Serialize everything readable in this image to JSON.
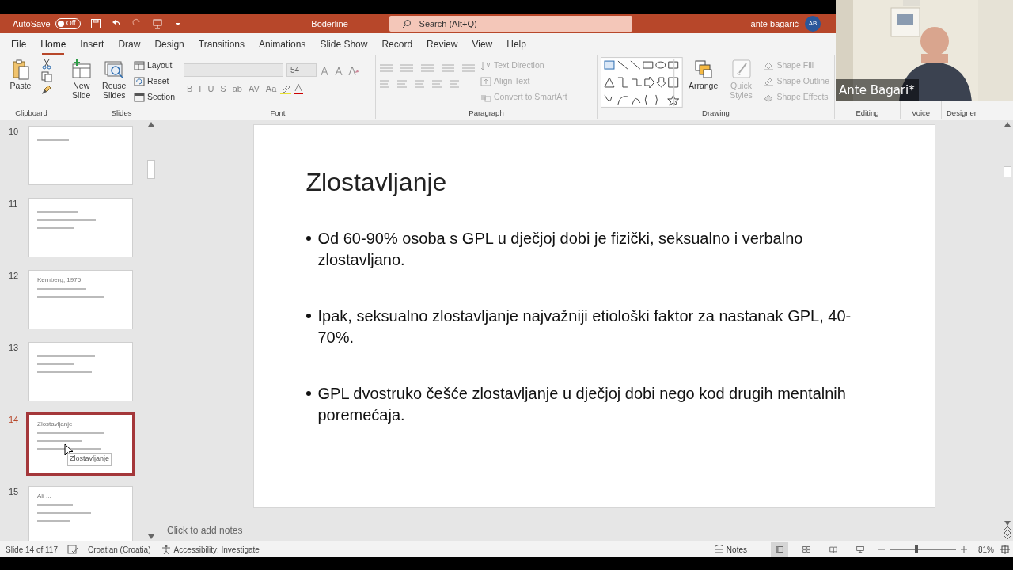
{
  "title_bar": {
    "autosave_label": "AutoSave",
    "autosave_state": "Off",
    "autosave_on": false,
    "file_name": "Boderline",
    "search_placeholder": "Search (Alt+Q)",
    "user_name": "ante bagarić",
    "user_initials": "AB"
  },
  "menu_tabs": [
    {
      "label": "File",
      "selected": false
    },
    {
      "label": "Home",
      "selected": true
    },
    {
      "label": "Insert",
      "selected": false
    },
    {
      "label": "Draw",
      "selected": false
    },
    {
      "label": "Design",
      "selected": false
    },
    {
      "label": "Transitions",
      "selected": false
    },
    {
      "label": "Animations",
      "selected": false
    },
    {
      "label": "Slide Show",
      "selected": false
    },
    {
      "label": "Record",
      "selected": false
    },
    {
      "label": "Review",
      "selected": false
    },
    {
      "label": "View",
      "selected": false
    },
    {
      "label": "Help",
      "selected": false
    }
  ],
  "ribbon": {
    "groups": [
      {
        "kind": "clipboard",
        "label": "Clipboard",
        "items": [
          {
            "kind": "large",
            "label": "Paste",
            "disabled": false
          }
        ]
      },
      {
        "kind": "buttons",
        "label": "Slides",
        "items": [
          {
            "kind": "large",
            "label": "New Slide",
            "disabled": false
          },
          {
            "kind": "large",
            "label": "Reuse Slides",
            "disabled": false
          },
          {
            "kind": "small",
            "label": "Layout",
            "disabled": false
          },
          {
            "kind": "small",
            "label": "Reset",
            "disabled": false
          },
          {
            "kind": "small",
            "label": "Section",
            "disabled": false
          }
        ]
      },
      {
        "kind": "font",
        "label": "Font",
        "font_size": "54",
        "buttons": [
          "B",
          "I",
          "U",
          "S",
          "ab",
          "AV",
          "Aa"
        ]
      },
      {
        "kind": "paragraph",
        "label": "Paragraph",
        "items": [
          {
            "kind": "small",
            "label": "Text Direction",
            "disabled": true
          },
          {
            "kind": "small",
            "label": "Align Text",
            "disabled": true
          },
          {
            "kind": "small",
            "label": "Convert to SmartArt",
            "disabled": true
          }
        ]
      },
      {
        "kind": "drawing",
        "label": "Drawing",
        "items": [
          {
            "kind": "large",
            "label": "Arrange",
            "disabled": false
          },
          {
            "kind": "large",
            "label": "Quick Styles",
            "disabled": true
          },
          {
            "kind": "small",
            "label": "Shape Fill",
            "disabled": true
          },
          {
            "kind": "small",
            "label": "Shape Outline",
            "disabled": true
          },
          {
            "kind": "small",
            "label": "Shape Effects",
            "disabled": true
          }
        ]
      },
      {
        "kind": "hidden",
        "label": "Editing"
      },
      {
        "kind": "hidden",
        "label": "Voice"
      },
      {
        "kind": "hidden",
        "label": "Designer"
      }
    ]
  },
  "thumbnails": [
    {
      "number": "10",
      "selected": false
    },
    {
      "number": "11",
      "selected": false
    },
    {
      "number": "12",
      "title": "Kernberg, 1975",
      "selected": false
    },
    {
      "number": "13",
      "selected": false
    },
    {
      "number": "14",
      "title": "Zlostavljanje",
      "selected": true,
      "tooltip": "Zlostavljanje"
    },
    {
      "number": "15",
      "title": "Ali ...",
      "selected": false
    }
  ],
  "slide": {
    "title": "Zlostavljanje",
    "bullets": [
      "Od 60-90% osoba s GPL u dječjoj dobi je fizički, seksualno i verbalno zlostavljano.",
      "Ipak, seksualno zlostavljanje najvažniji etiološki faktor za nastanak GPL, 40-70%.",
      "GPL dvostruko češće zlostavljanje u dječjoj dobi nego kod drugih mentalnih poremećaja."
    ]
  },
  "notes": {
    "placeholder": "Click to add notes"
  },
  "status_bar": {
    "slide_counter": "Slide 14 of 117",
    "language": "Croatian (Croatia)",
    "accessibility": "Accessibility: Investigate",
    "notes_button": "Notes",
    "views": [
      {
        "kind": "normal",
        "selected": true
      },
      {
        "kind": "sorter",
        "selected": false
      },
      {
        "kind": "reading",
        "selected": false
      },
      {
        "kind": "slideshow",
        "selected": false
      }
    ],
    "zoom": {
      "level": 0.4
    },
    "zoom_percent": "81%"
  },
  "video": {
    "participant_name": "Ante Bagari*"
  }
}
